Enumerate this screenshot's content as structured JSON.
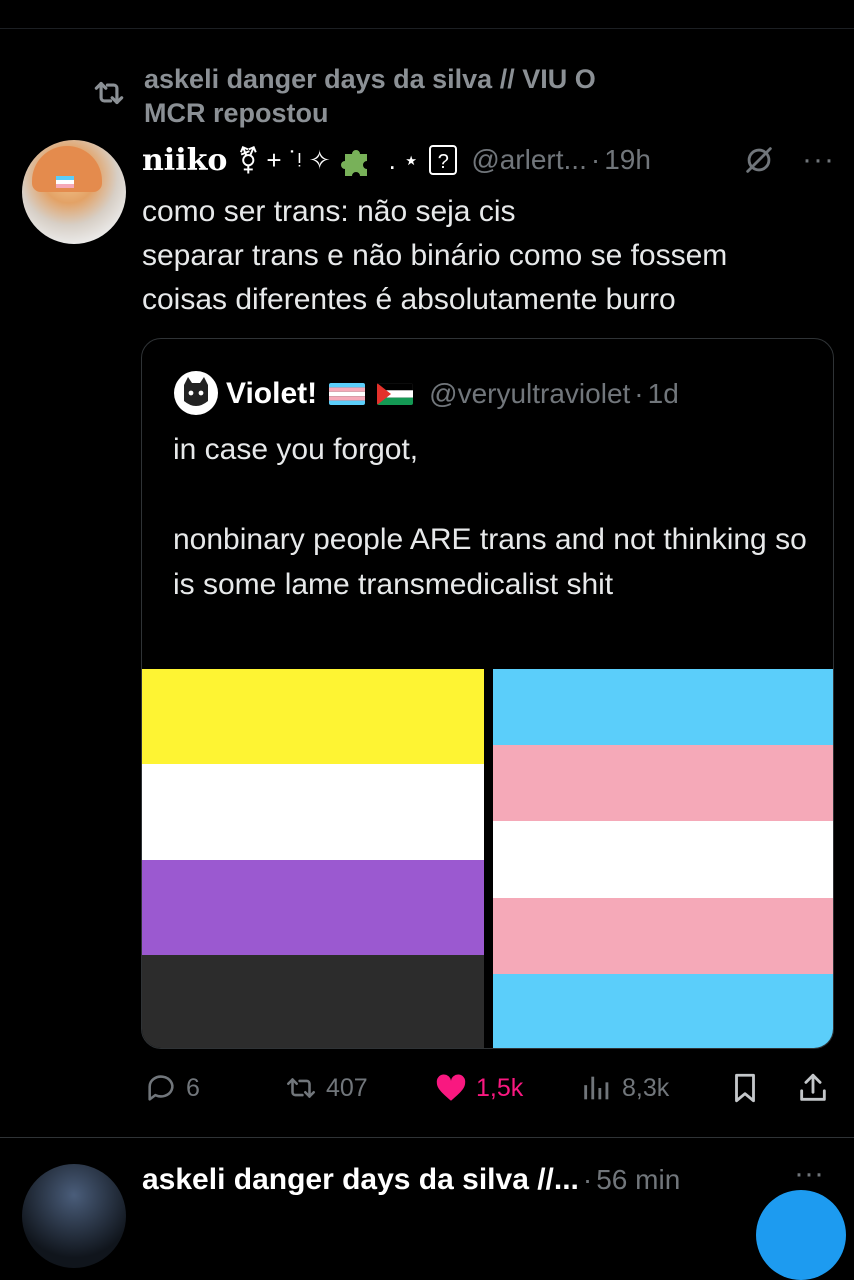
{
  "repost": {
    "icon": "repost-icon",
    "line1": "askeli danger days da silva // VIU O",
    "line2": "MCR repostou"
  },
  "tweet": {
    "display_name": "niiko",
    "decorations": "⚧ + ˙ᵎ ✧",
    "decoration_after": ". ⋆",
    "question_glyph": "?",
    "handle": "@arlert...",
    "separator": "·",
    "time": "19h",
    "text_lines": [
      "como ser trans: não seja cis",
      "separar trans e não binário como se fossem",
      "coisas diferentes é absolutamente burro"
    ],
    "icons": [
      "grok-icon",
      "more-icon"
    ]
  },
  "quote": {
    "display_name": "Violet!",
    "handle": "@veryultraviolet",
    "separator": "·",
    "time": "1d",
    "text": "in case you forgot,\n\nnonbinary people ARE trans and not thinking so is some lame transmedicalist shit",
    "nonbinary_flag_colors": [
      "#fef433",
      "#ffffff",
      "#9b59d0",
      "#2c2c2c"
    ],
    "trans_flag_colors": [
      "#5bcefa",
      "#f5a9b8",
      "#ffffff",
      "#f5a9b8",
      "#5bcefa"
    ]
  },
  "actions": {
    "replies": "6",
    "reposts": "407",
    "likes": "1,5k",
    "views": "8,3k",
    "liked_color": "#f91880"
  },
  "next_tweet": {
    "display_name": "askeli danger days da silva //...",
    "separator": "·",
    "time": "56 min",
    "more": "···"
  }
}
